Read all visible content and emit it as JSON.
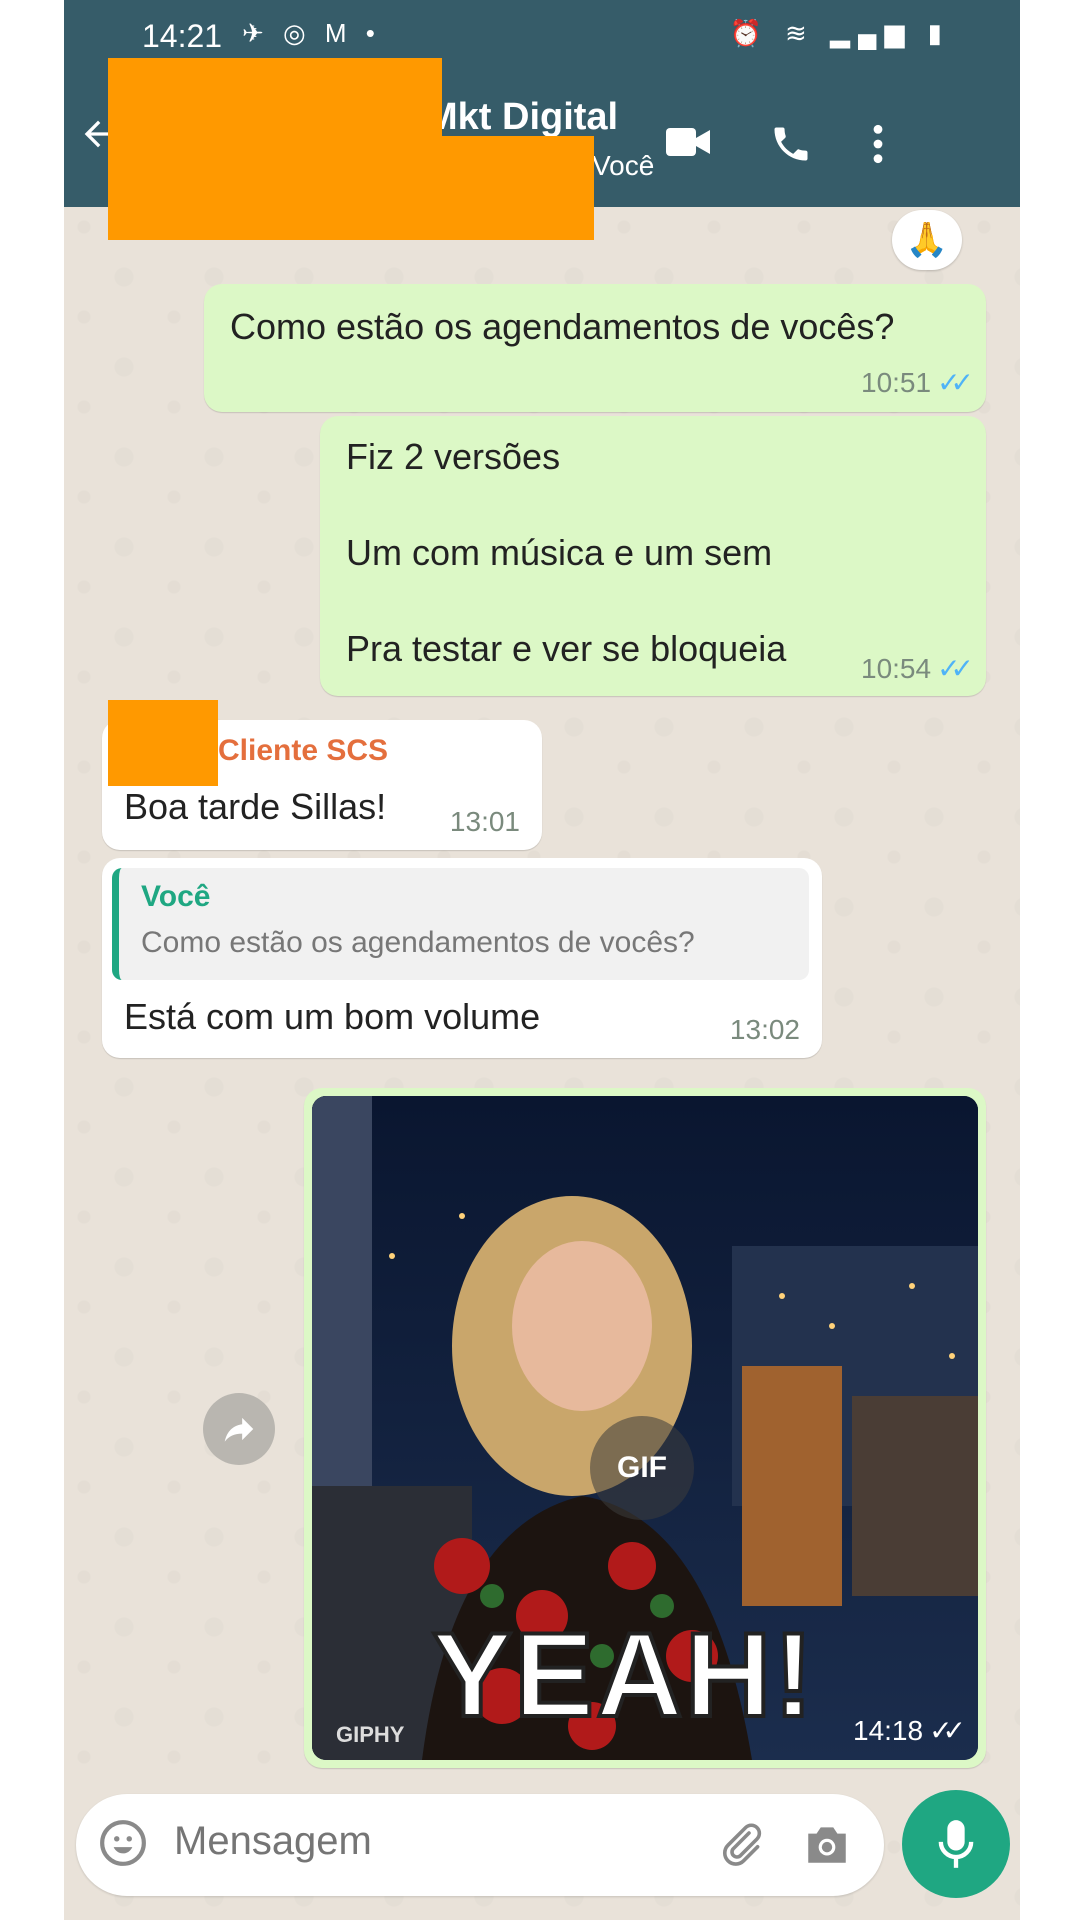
{
  "status_bar": {
    "time": "14:21",
    "left_icons": "✈ ◎ M •",
    "right_icons": "⏰ ≋ ▂▄▆ ▮"
  },
  "header": {
    "title": "Mkt Digital",
    "subtitle": "Você",
    "back_icon": "arrow-left-icon",
    "video_icon": "video-camera-icon",
    "call_icon": "phone-icon",
    "menu_icon": "more-vertical-icon"
  },
  "reaction": {
    "emoji": "🙏"
  },
  "messages": [
    {
      "dir": "out",
      "text": "Como estão os agendamentos de vocês?",
      "time": "10:51",
      "ticks": "✓✓"
    },
    {
      "dir": "out",
      "lines": [
        "Fiz 2 versões",
        "Um com música e um sem",
        "Pra testar e ver se bloqueia"
      ],
      "time": "10:54",
      "ticks": "✓✓"
    },
    {
      "dir": "in",
      "sender": "Cliente SCS",
      "text": "Boa tarde Sillas!",
      "time": "13:01"
    },
    {
      "dir": "in",
      "quote_author": "Você",
      "quote_text": "Como estão os agendamentos de vocês?",
      "text": "Está com um bom volume",
      "time": "13:02"
    }
  ],
  "gif_message": {
    "badge": "GIF",
    "caption_text": "YEAH!",
    "provider": "GIPHY",
    "time": "14:18",
    "ticks": "✓✓",
    "forward_icon": "forward-arrow-icon"
  },
  "input": {
    "placeholder": "Mensagem",
    "emoji_icon": "emoji-icon",
    "attach_icon": "paperclip-icon",
    "camera_icon": "camera-icon",
    "mic_icon": "microphone-icon"
  },
  "colors": {
    "header": "#365c69",
    "outgoing": "#dcf8c6",
    "incoming": "#ffffff",
    "accent": "#1fa782",
    "sender": "#e46f3d",
    "redaction": "#ff9900"
  }
}
